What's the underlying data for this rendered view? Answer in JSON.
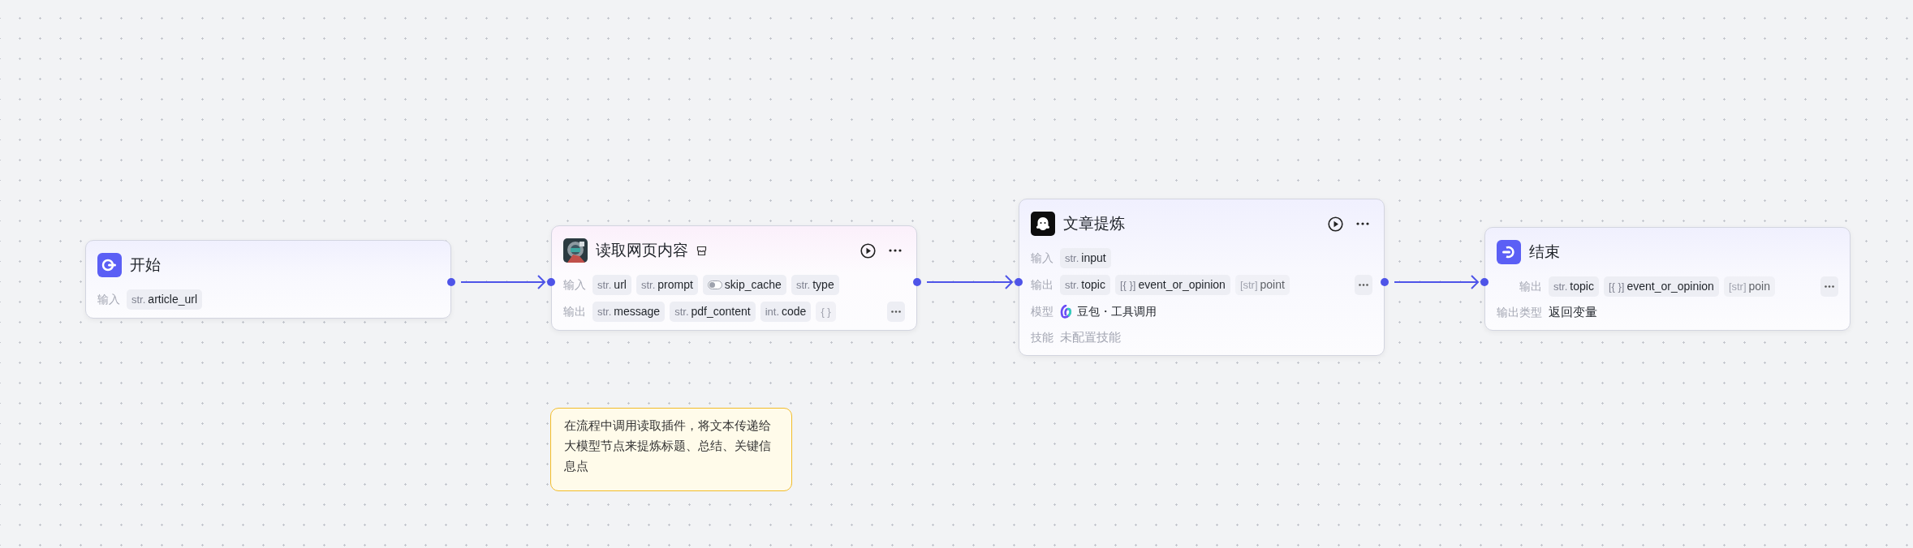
{
  "nodes": [
    {
      "title": "开始",
      "kind": "start",
      "badge": false,
      "actions": false,
      "in_handle": false,
      "out_handle": true,
      "rows": [
        {
          "kind": "vars",
          "label": "输入",
          "more": false,
          "vars": [
            {
              "kind": "typed",
              "type": "str.",
              "name": "article_url",
              "faded": false
            }
          ]
        }
      ]
    },
    {
      "title": "读取网页内容",
      "kind": "plugin",
      "badge": true,
      "actions": true,
      "in_handle": true,
      "out_handle": true,
      "rows": [
        {
          "kind": "vars",
          "label": "输入",
          "more": false,
          "vars": [
            {
              "kind": "typed",
              "type": "str.",
              "name": "url",
              "faded": false
            },
            {
              "kind": "typed",
              "type": "str.",
              "name": "prompt",
              "faded": false
            },
            {
              "kind": "toggle",
              "name": "skip_cache",
              "faded": false
            },
            {
              "kind": "typed",
              "type": "str.",
              "name": "type",
              "faded": false
            }
          ]
        },
        {
          "kind": "vars",
          "label": "输出",
          "more": true,
          "vars": [
            {
              "kind": "typed",
              "type": "str.",
              "name": "message",
              "faded": false
            },
            {
              "kind": "typed",
              "type": "str.",
              "name": "pdf_content",
              "faded": false
            },
            {
              "kind": "typed",
              "type": "int.",
              "name": "code",
              "faded": false
            },
            {
              "kind": "typed",
              "type": "{ }",
              "faded": true
            }
          ]
        }
      ]
    },
    {
      "title": "文章提炼",
      "kind": "llm",
      "badge": false,
      "actions": true,
      "in_handle": true,
      "out_handle": true,
      "rows": [
        {
          "kind": "vars",
          "label": "输入",
          "more": false,
          "vars": [
            {
              "kind": "typed",
              "type": "str.",
              "name": "input",
              "faded": false
            }
          ]
        },
        {
          "kind": "vars",
          "label": "输出",
          "more": true,
          "vars": [
            {
              "kind": "typed",
              "type": "str.",
              "name": "topic",
              "faded": false
            },
            {
              "kind": "typed",
              "type": "[{ }]",
              "name": "event_or_opinion",
              "faded": false
            },
            {
              "kind": "typed",
              "type": "[str]",
              "name": "point",
              "faded": true
            }
          ]
        },
        {
          "kind": "model",
          "label": "模型",
          "text": "豆包・工具调用"
        },
        {
          "kind": "text",
          "label": "技能",
          "text": "未配置技能",
          "muted": true
        }
      ]
    },
    {
      "title": "结束",
      "kind": "end",
      "badge": false,
      "actions": false,
      "in_handle": true,
      "out_handle": false,
      "rows": [
        {
          "kind": "vars",
          "label": "输出",
          "more": true,
          "vars": [
            {
              "kind": "typed",
              "type": "str.",
              "name": "topic",
              "faded": false
            },
            {
              "kind": "typed",
              "type": "[{ }]",
              "name": "event_or_opinion",
              "faded": false
            },
            {
              "kind": "typed",
              "type": "[str]",
              "name": "poin",
              "faded": true
            }
          ]
        },
        {
          "kind": "text",
          "label": "输出类型",
          "text": "返回变量",
          "muted": false
        }
      ]
    }
  ],
  "note": {
    "text": "在流程中调用读取插件，将文本传递给大模型节点来提炼标题、总结、关键信息点"
  }
}
